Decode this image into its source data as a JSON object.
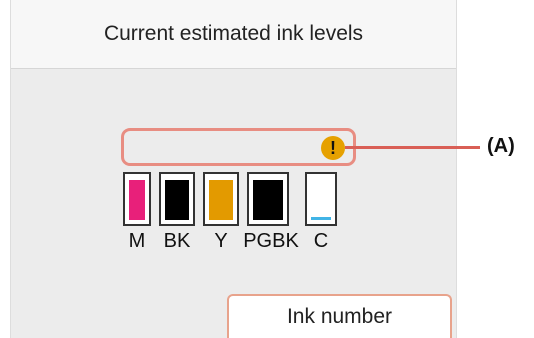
{
  "header": {
    "title": "Current estimated ink levels"
  },
  "warning": {
    "icon": "exclamation-icon",
    "symbol": "!"
  },
  "tanks": [
    {
      "label": "M",
      "color": "#e8207a",
      "level": 0.95
    },
    {
      "label": "BK",
      "color": "#000000",
      "level": 0.95
    },
    {
      "label": "Y",
      "color": "#e39a00",
      "level": 0.95
    },
    {
      "label": "PGBK",
      "color": "#000000",
      "level": 0.95
    },
    {
      "label": "C",
      "color": "#41b4e6",
      "level": 0.08
    }
  ],
  "footer": {
    "ink_number_label": "Ink number"
  },
  "callout": {
    "label": "(A)"
  }
}
